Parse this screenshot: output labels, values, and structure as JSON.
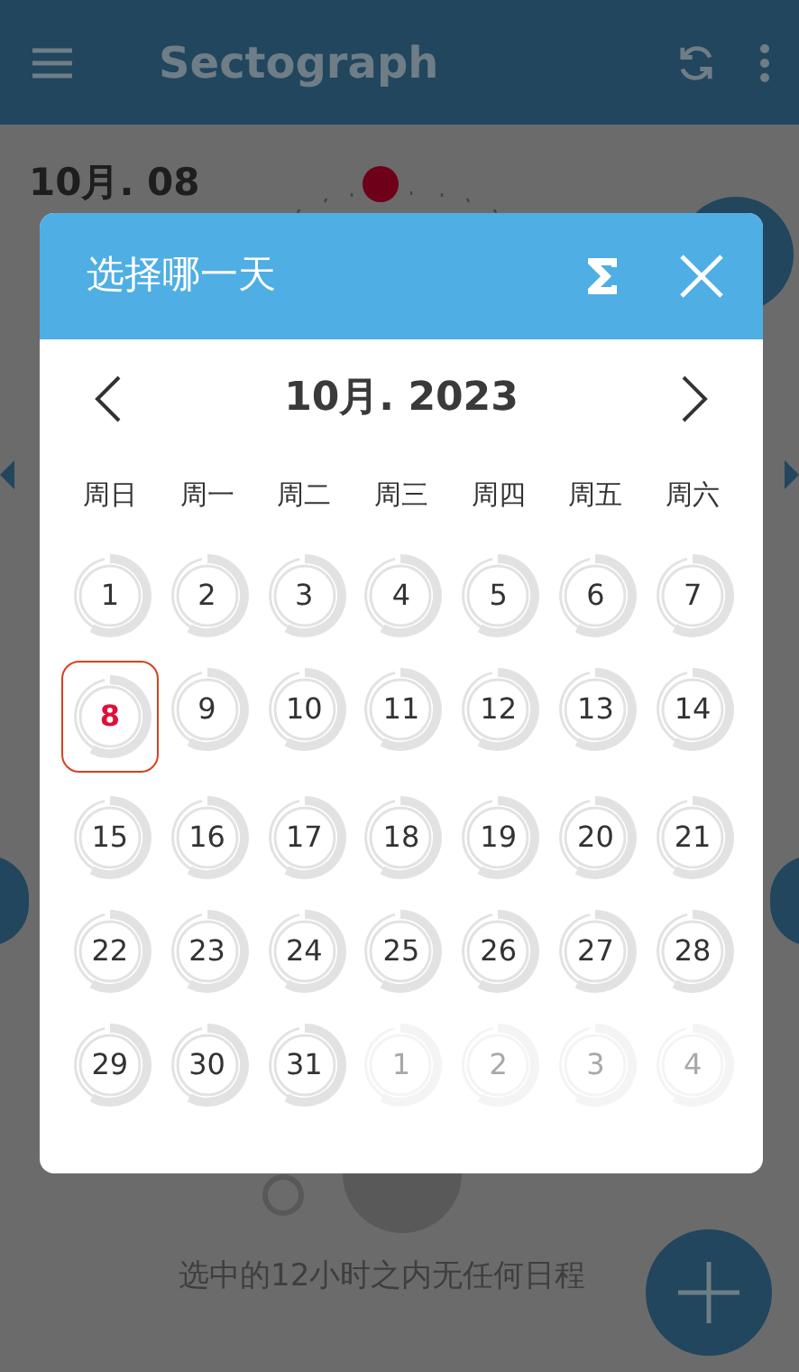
{
  "app_bar": {
    "title": "Sectograph"
  },
  "current_date": {
    "date": "10月. 08"
  },
  "empty_message": "选中的12小时之内无任何日程",
  "dialog": {
    "title": "选择哪一天",
    "month_label": "10月. 2023",
    "weekdays": [
      "周日",
      "周一",
      "周二",
      "周三",
      "周四",
      "周五",
      "周六"
    ],
    "days": [
      {
        "label": "1",
        "selected": false,
        "in_month": true
      },
      {
        "label": "2",
        "selected": false,
        "in_month": true
      },
      {
        "label": "3",
        "selected": false,
        "in_month": true
      },
      {
        "label": "4",
        "selected": false,
        "in_month": true
      },
      {
        "label": "5",
        "selected": false,
        "in_month": true
      },
      {
        "label": "6",
        "selected": false,
        "in_month": true
      },
      {
        "label": "7",
        "selected": false,
        "in_month": true
      },
      {
        "label": "8",
        "selected": true,
        "in_month": true
      },
      {
        "label": "9",
        "selected": false,
        "in_month": true
      },
      {
        "label": "10",
        "selected": false,
        "in_month": true
      },
      {
        "label": "11",
        "selected": false,
        "in_month": true
      },
      {
        "label": "12",
        "selected": false,
        "in_month": true
      },
      {
        "label": "13",
        "selected": false,
        "in_month": true
      },
      {
        "label": "14",
        "selected": false,
        "in_month": true
      },
      {
        "label": "15",
        "selected": false,
        "in_month": true
      },
      {
        "label": "16",
        "selected": false,
        "in_month": true
      },
      {
        "label": "17",
        "selected": false,
        "in_month": true
      },
      {
        "label": "18",
        "selected": false,
        "in_month": true
      },
      {
        "label": "19",
        "selected": false,
        "in_month": true
      },
      {
        "label": "20",
        "selected": false,
        "in_month": true
      },
      {
        "label": "21",
        "selected": false,
        "in_month": true
      },
      {
        "label": "22",
        "selected": false,
        "in_month": true
      },
      {
        "label": "23",
        "selected": false,
        "in_month": true
      },
      {
        "label": "24",
        "selected": false,
        "in_month": true
      },
      {
        "label": "25",
        "selected": false,
        "in_month": true
      },
      {
        "label": "26",
        "selected": false,
        "in_month": true
      },
      {
        "label": "27",
        "selected": false,
        "in_month": true
      },
      {
        "label": "28",
        "selected": false,
        "in_month": true
      },
      {
        "label": "29",
        "selected": false,
        "in_month": true
      },
      {
        "label": "30",
        "selected": false,
        "in_month": true
      },
      {
        "label": "31",
        "selected": false,
        "in_month": true
      },
      {
        "label": "1",
        "selected": false,
        "in_month": false
      },
      {
        "label": "2",
        "selected": false,
        "in_month": false
      },
      {
        "label": "3",
        "selected": false,
        "in_month": false
      },
      {
        "label": "4",
        "selected": false,
        "in_month": false
      }
    ]
  }
}
